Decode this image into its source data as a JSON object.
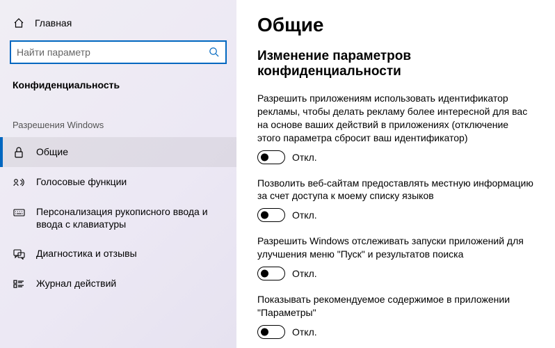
{
  "sidebar": {
    "home": "Главная",
    "search_placeholder": "Найти параметр",
    "section": "Конфиденциальность",
    "group": "Разрешения Windows",
    "items": [
      {
        "label": "Общие",
        "selected": true
      },
      {
        "label": "Голосовые функции",
        "selected": false
      },
      {
        "label": "Персонализация рукописного ввода и ввода с клавиатуры",
        "selected": false
      },
      {
        "label": "Диагностика и отзывы",
        "selected": false
      },
      {
        "label": "Журнал действий",
        "selected": false
      }
    ]
  },
  "main": {
    "title": "Общие",
    "subtitle": "Изменение параметров конфиденциальности",
    "settings": [
      {
        "desc": "Разрешить приложениям использовать идентификатор рекламы, чтобы делать рекламу более интересной для вас на основе ваших действий в приложениях (отключение этого параметра сбросит ваш идентификатор)",
        "state": "Откл."
      },
      {
        "desc": "Позволить веб-сайтам предоставлять местную информацию за счет доступа к моему списку языков",
        "state": "Откл."
      },
      {
        "desc": "Разрешить Windows отслеживать запуски приложений для улучшения меню \"Пуск\" и результатов поиска",
        "state": "Откл."
      },
      {
        "desc": "Показывать рекомендуемое содержимое в приложении \"Параметры\"",
        "state": "Откл."
      }
    ]
  }
}
